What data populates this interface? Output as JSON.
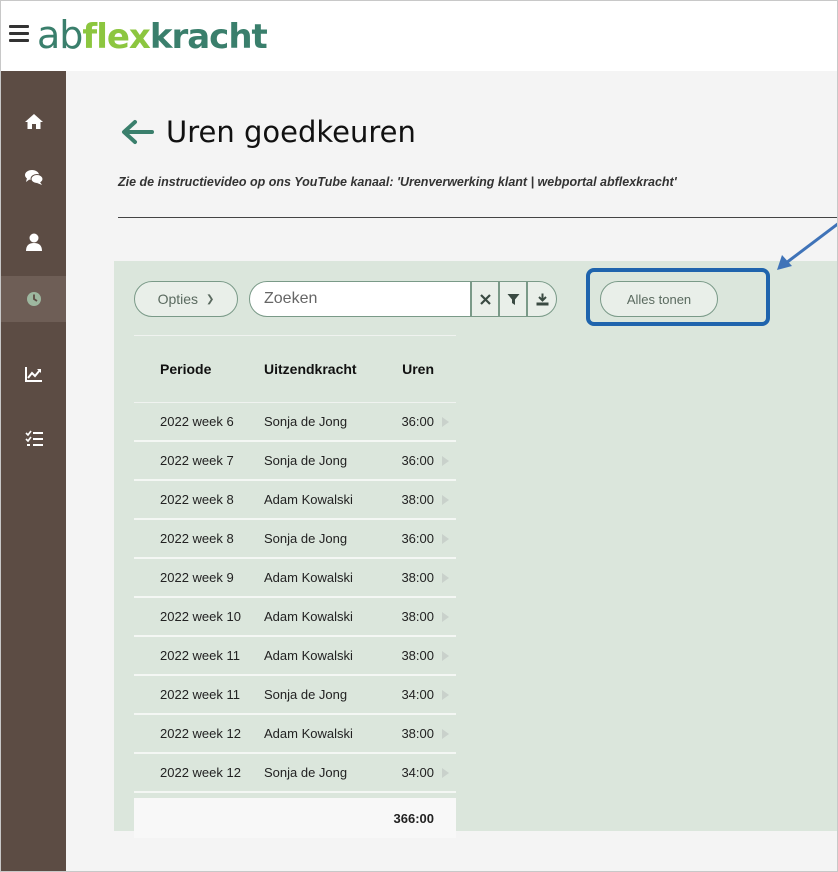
{
  "header": {
    "logo": {
      "part1": "ab",
      "part2": "flex",
      "part3": "kracht"
    }
  },
  "sidebar": {
    "items": [
      {
        "icon": "home-icon"
      },
      {
        "icon": "chat-icon"
      },
      {
        "icon": "user-icon"
      },
      {
        "icon": "clock-icon",
        "active": true
      },
      {
        "icon": "chart-icon"
      },
      {
        "icon": "list-icon"
      }
    ]
  },
  "page": {
    "title": "Uren goedkeuren",
    "instruction": "Zie de instructievideo op ons YouTube kanaal: 'Urenverwerking klant | webportal abflexkracht'"
  },
  "toolbar": {
    "options_label": "Opties",
    "search_placeholder": "Zoeken",
    "show_all_label": "Alles tonen"
  },
  "table": {
    "headers": [
      "Periode",
      "Uitzendkracht",
      "Uren"
    ],
    "rows": [
      {
        "periode": "2022 week 6",
        "uitzendkracht": "Sonja de Jong",
        "uren": "36:00"
      },
      {
        "periode": "2022 week 7",
        "uitzendkracht": "Sonja de Jong",
        "uren": "36:00"
      },
      {
        "periode": "2022 week 8",
        "uitzendkracht": "Adam Kowalski",
        "uren": "38:00"
      },
      {
        "periode": "2022 week 8",
        "uitzendkracht": "Sonja de Jong",
        "uren": "36:00"
      },
      {
        "periode": "2022 week 9",
        "uitzendkracht": "Adam Kowalski",
        "uren": "38:00"
      },
      {
        "periode": "2022 week 10",
        "uitzendkracht": "Adam Kowalski",
        "uren": "38:00"
      },
      {
        "periode": "2022 week 11",
        "uitzendkracht": "Adam Kowalski",
        "uren": "38:00"
      },
      {
        "periode": "2022 week 11",
        "uitzendkracht": "Sonja de Jong",
        "uren": "34:00"
      },
      {
        "periode": "2022 week 12",
        "uitzendkracht": "Adam Kowalski",
        "uren": "38:00"
      },
      {
        "periode": "2022 week 12",
        "uitzendkracht": "Sonja de Jong",
        "uren": "34:00"
      }
    ],
    "total": "366:00"
  },
  "colors": {
    "sidebar_bg": "#5c4c44",
    "sidebar_active": "#6e5e56",
    "panel_bg": "#dbe6dc",
    "brand_green": "#3a7f6c",
    "brand_lime": "#8cc63f",
    "annotation_blue": "#1f64ad"
  }
}
